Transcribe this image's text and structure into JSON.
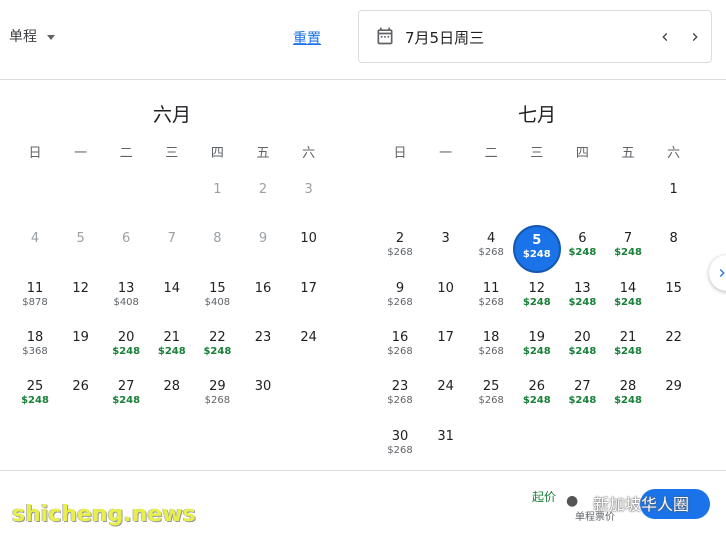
{
  "header": {
    "trip_type": "单程",
    "reset_label": "重置",
    "selected_date": "7月5日周三"
  },
  "weekdays": [
    "日",
    "一",
    "二",
    "三",
    "四",
    "五",
    "六"
  ],
  "months": [
    {
      "title": "六月",
      "days": [
        {
          "n": "1",
          "col": 4,
          "row": 0,
          "disabled": true,
          "price": ""
        },
        {
          "n": "2",
          "col": 5,
          "row": 0,
          "disabled": true,
          "price": ""
        },
        {
          "n": "3",
          "col": 6,
          "row": 0,
          "disabled": true,
          "price": ""
        },
        {
          "n": "4",
          "col": 0,
          "row": 1,
          "disabled": true,
          "price": ""
        },
        {
          "n": "5",
          "col": 1,
          "row": 1,
          "disabled": true,
          "price": ""
        },
        {
          "n": "6",
          "col": 2,
          "row": 1,
          "disabled": true,
          "price": ""
        },
        {
          "n": "7",
          "col": 3,
          "row": 1,
          "disabled": true,
          "price": ""
        },
        {
          "n": "8",
          "col": 4,
          "row": 1,
          "disabled": true,
          "price": ""
        },
        {
          "n": "9",
          "col": 5,
          "row": 1,
          "disabled": true,
          "price": ""
        },
        {
          "n": "10",
          "col": 6,
          "row": 1,
          "price": ""
        },
        {
          "n": "11",
          "col": 0,
          "row": 2,
          "price": "$878"
        },
        {
          "n": "12",
          "col": 1,
          "row": 2,
          "price": ""
        },
        {
          "n": "13",
          "col": 2,
          "row": 2,
          "price": "$408"
        },
        {
          "n": "14",
          "col": 3,
          "row": 2,
          "price": ""
        },
        {
          "n": "15",
          "col": 4,
          "row": 2,
          "price": "$408"
        },
        {
          "n": "16",
          "col": 5,
          "row": 2,
          "price": ""
        },
        {
          "n": "17",
          "col": 6,
          "row": 2,
          "price": ""
        },
        {
          "n": "18",
          "col": 0,
          "row": 3,
          "price": "$368"
        },
        {
          "n": "19",
          "col": 1,
          "row": 3,
          "price": ""
        },
        {
          "n": "20",
          "col": 2,
          "row": 3,
          "price": "$248",
          "low": true
        },
        {
          "n": "21",
          "col": 3,
          "row": 3,
          "price": "$248",
          "low": true
        },
        {
          "n": "22",
          "col": 4,
          "row": 3,
          "price": "$248",
          "low": true
        },
        {
          "n": "23",
          "col": 5,
          "row": 3,
          "price": ""
        },
        {
          "n": "24",
          "col": 6,
          "row": 3,
          "price": ""
        },
        {
          "n": "25",
          "col": 0,
          "row": 4,
          "price": "$248",
          "low": true
        },
        {
          "n": "26",
          "col": 1,
          "row": 4,
          "price": ""
        },
        {
          "n": "27",
          "col": 2,
          "row": 4,
          "price": "$248",
          "low": true
        },
        {
          "n": "28",
          "col": 3,
          "row": 4,
          "price": ""
        },
        {
          "n": "29",
          "col": 4,
          "row": 4,
          "price": "$268"
        },
        {
          "n": "30",
          "col": 5,
          "row": 4,
          "price": ""
        }
      ]
    },
    {
      "title": "七月",
      "days": [
        {
          "n": "1",
          "col": 6,
          "row": 0,
          "price": ""
        },
        {
          "n": "2",
          "col": 0,
          "row": 1,
          "price": "$268"
        },
        {
          "n": "3",
          "col": 1,
          "row": 1,
          "price": ""
        },
        {
          "n": "4",
          "col": 2,
          "row": 1,
          "price": "$268"
        },
        {
          "n": "5",
          "col": 3,
          "row": 1,
          "price": "$248",
          "selected": true
        },
        {
          "n": "6",
          "col": 4,
          "row": 1,
          "price": "$248",
          "low": true
        },
        {
          "n": "7",
          "col": 5,
          "row": 1,
          "price": "$248",
          "low": true
        },
        {
          "n": "8",
          "col": 6,
          "row": 1,
          "price": ""
        },
        {
          "n": "9",
          "col": 0,
          "row": 2,
          "price": "$268"
        },
        {
          "n": "10",
          "col": 1,
          "row": 2,
          "price": ""
        },
        {
          "n": "11",
          "col": 2,
          "row": 2,
          "price": "$268"
        },
        {
          "n": "12",
          "col": 3,
          "row": 2,
          "price": "$248",
          "low": true
        },
        {
          "n": "13",
          "col": 4,
          "row": 2,
          "price": "$248",
          "low": true
        },
        {
          "n": "14",
          "col": 5,
          "row": 2,
          "price": "$248",
          "low": true
        },
        {
          "n": "15",
          "col": 6,
          "row": 2,
          "price": ""
        },
        {
          "n": "16",
          "col": 0,
          "row": 3,
          "price": "$268"
        },
        {
          "n": "17",
          "col": 1,
          "row": 3,
          "price": ""
        },
        {
          "n": "18",
          "col": 2,
          "row": 3,
          "price": "$268"
        },
        {
          "n": "19",
          "col": 3,
          "row": 3,
          "price": "$248",
          "low": true
        },
        {
          "n": "20",
          "col": 4,
          "row": 3,
          "price": "$248",
          "low": true
        },
        {
          "n": "21",
          "col": 5,
          "row": 3,
          "price": "$248",
          "low": true
        },
        {
          "n": "22",
          "col": 6,
          "row": 3,
          "price": ""
        },
        {
          "n": "23",
          "col": 0,
          "row": 4,
          "price": "$268"
        },
        {
          "n": "24",
          "col": 1,
          "row": 4,
          "price": ""
        },
        {
          "n": "25",
          "col": 2,
          "row": 4,
          "price": "$268"
        },
        {
          "n": "26",
          "col": 3,
          "row": 4,
          "price": "$248",
          "low": true
        },
        {
          "n": "27",
          "col": 4,
          "row": 4,
          "price": "$248",
          "low": true
        },
        {
          "n": "28",
          "col": 5,
          "row": 4,
          "price": "$248",
          "low": true
        },
        {
          "n": "29",
          "col": 6,
          "row": 4,
          "price": ""
        },
        {
          "n": "30",
          "col": 0,
          "row": 5,
          "price": "$268"
        },
        {
          "n": "31",
          "col": 1,
          "row": 5,
          "price": ""
        }
      ]
    }
  ],
  "footer": {
    "price_prefix": "起价",
    "subtext": "单程票价",
    "watermark": "新加坡华人圈"
  },
  "site_watermark": "shicheng.news",
  "colors": {
    "accent": "#1a73e8",
    "low_price": "#188038"
  }
}
